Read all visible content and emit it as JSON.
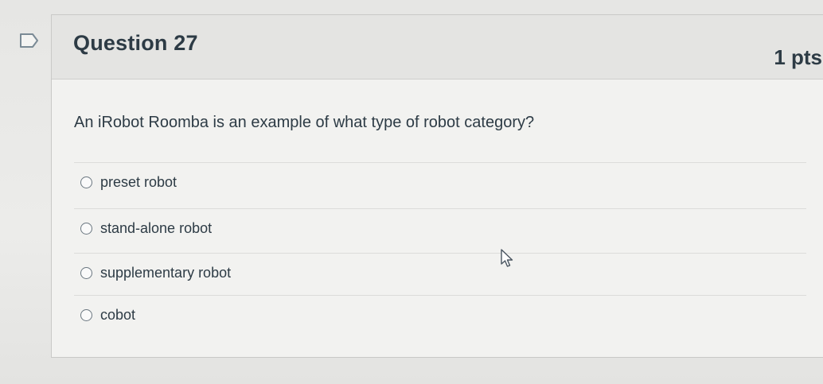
{
  "question": {
    "title": "Question 27",
    "points": "1 pts",
    "text": "An iRobot Roomba is an example of what type of robot category?",
    "answers": [
      {
        "label": "preset robot",
        "selected": false
      },
      {
        "label": "stand-alone robot",
        "selected": false
      },
      {
        "label": "supplementary robot",
        "selected": false
      },
      {
        "label": "cobot",
        "selected": false
      }
    ]
  },
  "icons": {
    "flag": "flag-question-icon",
    "cursor": "mouse-pointer-icon"
  },
  "colors": {
    "text": "#2d3b45",
    "header_bg": "#e4e4e2",
    "card_bg": "#f2f2f0",
    "flag_border": "#7a8a95"
  }
}
